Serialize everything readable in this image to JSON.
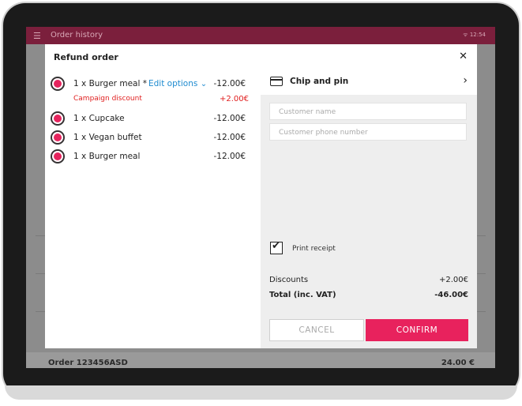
{
  "status_bar": {
    "menu_icon": "☰",
    "title": "Order history",
    "time": "12:54",
    "wifi_icon": "ᯤ"
  },
  "background": {
    "order_label": "Order 123456ASD",
    "order_total": "24.00 €"
  },
  "modal": {
    "title": "Refund order",
    "close_symbol": "✕",
    "items": [
      {
        "label": "1 x Burger meal *",
        "edit_label": "Edit options",
        "price": "-12.00€"
      },
      {
        "label": "1 x Cupcake",
        "price": "-12.00€"
      },
      {
        "label": "1 x Vegan buffet",
        "price": "-12.00€"
      },
      {
        "label": "1 x Burger meal",
        "price": "-12.00€"
      }
    ],
    "discount": {
      "label": "Campaign discount",
      "price": "+2.00€"
    },
    "payment": {
      "method": "Chip and pin",
      "chevron": "›"
    },
    "customer_name_placeholder": "Customer name",
    "customer_phone_placeholder": "Customer phone number",
    "print_receipt_label": "Print receipt",
    "print_receipt_checked": true,
    "discounts_label": "Discounts",
    "discounts_value": "+2.00€",
    "total_label": "Total (inc. VAT)",
    "total_value": "-46.00€",
    "cancel_label": "CANCEL",
    "confirm_label": "CONFIRM"
  },
  "colors": {
    "accent": "#e8225d",
    "link": "#1e8bd0",
    "discount": "#e01e1e",
    "status_bar": "#7b1f3c"
  }
}
